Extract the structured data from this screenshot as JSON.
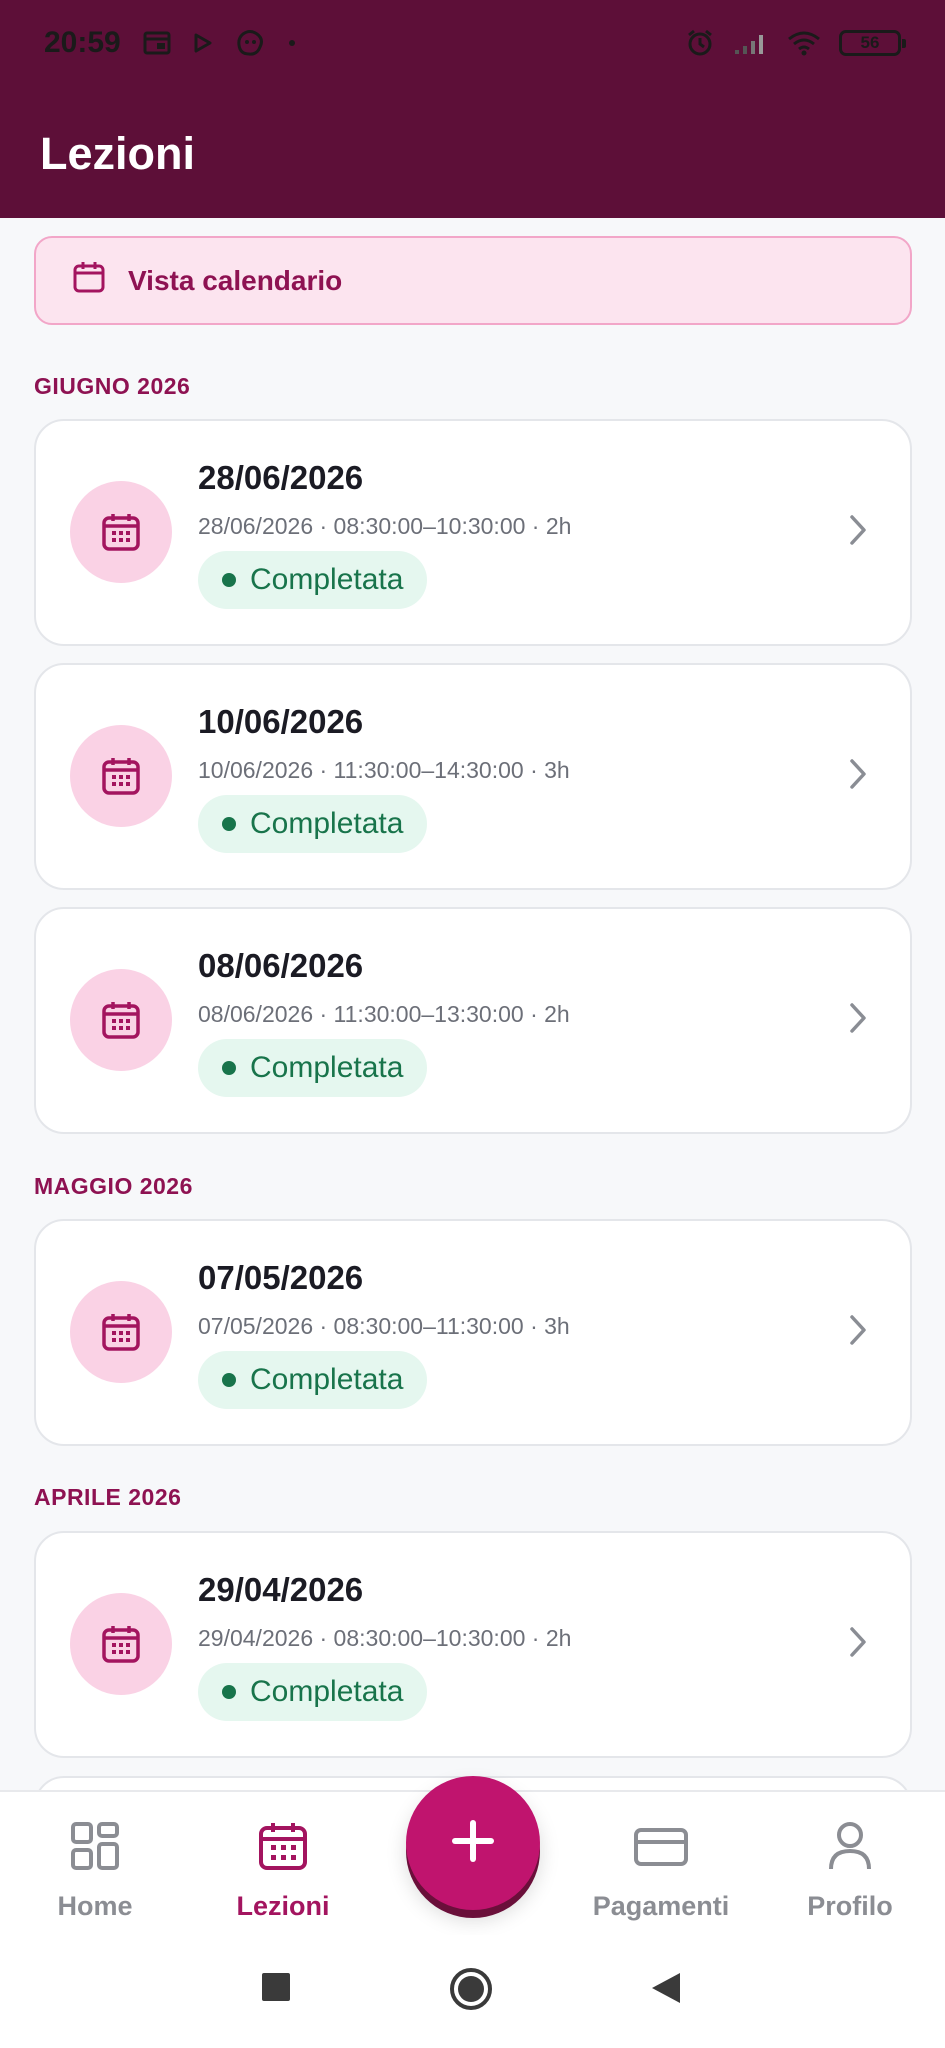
{
  "status_bar": {
    "time": "20:59",
    "battery": "56"
  },
  "header": {
    "title": "Lezioni"
  },
  "calendar_view": {
    "label": "Vista calendario"
  },
  "sections": [
    {
      "label": "GIUGNO 2026",
      "lessons": [
        {
          "date": "28/06/2026",
          "meta": "28/06/2026 · 08:30:00–10:30:00 · 2h",
          "status": "Completata"
        },
        {
          "date": "10/06/2026",
          "meta": "10/06/2026 · 11:30:00–14:30:00 · 3h",
          "status": "Completata"
        },
        {
          "date": "08/06/2026",
          "meta": "08/06/2026 · 11:30:00–13:30:00 · 2h",
          "status": "Completata"
        }
      ]
    },
    {
      "label": "MAGGIO 2026",
      "lessons": [
        {
          "date": "07/05/2026",
          "meta": "07/05/2026 · 08:30:00–11:30:00 · 3h",
          "status": "Completata"
        }
      ]
    },
    {
      "label": "APRILE 2026",
      "lessons": [
        {
          "date": "29/04/2026",
          "meta": "29/04/2026 · 08:30:00–10:30:00 · 2h",
          "status": "Completata"
        }
      ]
    }
  ],
  "bottom_nav": {
    "items": [
      {
        "label": "Home",
        "icon": "grid-icon",
        "active": false
      },
      {
        "label": "Lezioni",
        "icon": "calendar-icon",
        "active": true
      },
      {
        "label": "Pagamenti",
        "icon": "credit-card-icon",
        "active": false
      },
      {
        "label": "Profilo",
        "icon": "user-icon",
        "active": false
      }
    ],
    "fab_icon": "plus-icon"
  },
  "colors": {
    "header_bg": "#5d0f38",
    "accent": "#c0146e",
    "status_green": "#18744b"
  }
}
